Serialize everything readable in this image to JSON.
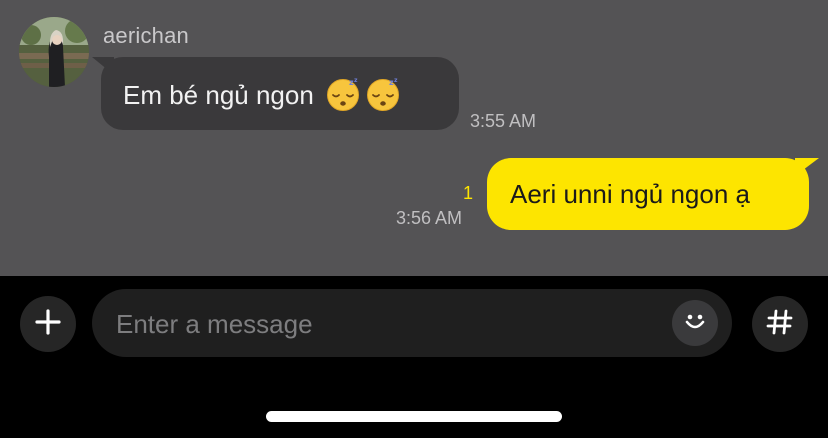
{
  "colors": {
    "chat_background": "#545355",
    "incoming_bubble": "#3a393b",
    "outgoing_bubble": "#fde500",
    "unread_count": "#fde500",
    "input_bar_background": "#000000"
  },
  "incoming_message": {
    "sender_name": "aerichan",
    "text": "Em bé ngủ ngon",
    "emojis": [
      "sleeping-face-emoji",
      "sleeping-face-emoji"
    ],
    "time": "3:55 AM"
  },
  "outgoing_message": {
    "text": "Aeri unni ngủ ngon ạ",
    "unread_count": "1",
    "time": "3:56 AM"
  },
  "composer": {
    "placeholder": "Enter a message",
    "value": "",
    "add_icon": "plus-icon",
    "emoji_icon": "smiley-icon",
    "hashtag_icon": "hash-icon"
  }
}
